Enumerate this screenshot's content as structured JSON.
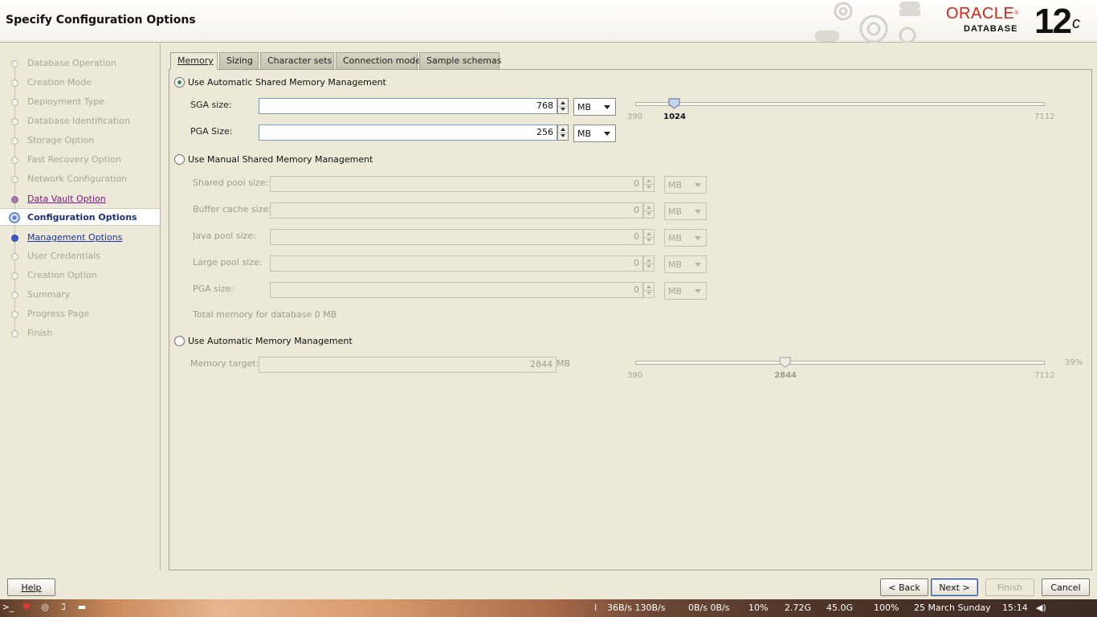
{
  "header": {
    "title": "Specify Configuration Options",
    "brand": "ORACLE",
    "product": "DATABASE",
    "version": "12",
    "version_suffix": "c"
  },
  "nav": {
    "items": [
      {
        "label": "Database Operation",
        "state": "disabled"
      },
      {
        "label": "Creation Mode",
        "state": "disabled"
      },
      {
        "label": "Deployment Type",
        "state": "disabled"
      },
      {
        "label": "Database Identification",
        "state": "disabled"
      },
      {
        "label": "Storage Option",
        "state": "disabled"
      },
      {
        "label": "Fast Recovery Option",
        "state": "disabled"
      },
      {
        "label": "Network Configuration",
        "state": "disabled"
      },
      {
        "label": "Data Vault Option",
        "state": "visited"
      },
      {
        "label": "Configuration Options",
        "state": "current"
      },
      {
        "label": "Management Options",
        "state": "link"
      },
      {
        "label": "User Credentials",
        "state": "disabled"
      },
      {
        "label": "Creation Option",
        "state": "disabled"
      },
      {
        "label": "Summary",
        "state": "disabled"
      },
      {
        "label": "Progress Page",
        "state": "disabled"
      },
      {
        "label": "Finish",
        "state": "disabled"
      }
    ]
  },
  "tabs": [
    {
      "label": "Memory",
      "active": true
    },
    {
      "label": "Sizing"
    },
    {
      "label": "Character sets"
    },
    {
      "label": "Connection mode"
    },
    {
      "label": "Sample schemas"
    }
  ],
  "memory": {
    "asmm": {
      "label": "Use Automatic Shared Memory Management",
      "selected": true,
      "sga_label": "SGA size:",
      "sga_value": "768",
      "sga_unit": "MB",
      "pga_label": "PGA Size:",
      "pga_value": "256",
      "pga_unit": "MB",
      "slider_min": "390",
      "slider_max": "7112",
      "slider_value": "1024",
      "slider_position": 0.0944
    },
    "manual": {
      "label": "Use Manual Shared Memory Management",
      "selected": false,
      "fields": [
        {
          "label": "Shared pool size:",
          "value": "0",
          "unit": "MB"
        },
        {
          "label": "Buffer cache size:",
          "value": "0",
          "unit": "MB"
        },
        {
          "label": "Java pool size:",
          "value": "0",
          "unit": "MB"
        },
        {
          "label": "Large pool size:",
          "value": "0",
          "unit": "MB"
        },
        {
          "label": "PGA size:",
          "value": "0",
          "unit": "MB"
        }
      ],
      "total": "Total memory for database 0 MB"
    },
    "amm": {
      "label": "Use Automatic Memory Management",
      "selected": false,
      "target_label": "Memory target:",
      "target_value": "2844",
      "target_unit": "MB",
      "slider_min": "390",
      "slider_max": "7112",
      "slider_value": "2844",
      "slider_position": 0.3651,
      "percent": "39%"
    }
  },
  "buttons": {
    "help": "Help",
    "back": "< Back",
    "next": "Next >",
    "finish": "Finish",
    "cancel": "Cancel"
  },
  "taskbar": {
    "net": "36B/s 130B/s",
    "disk": "0B/s 0B/s",
    "cpu": "10%",
    "mem": "2.72G",
    "storage": "45.0G",
    "battery": "100%",
    "date": "25 March Sunday",
    "time": "15:14"
  }
}
